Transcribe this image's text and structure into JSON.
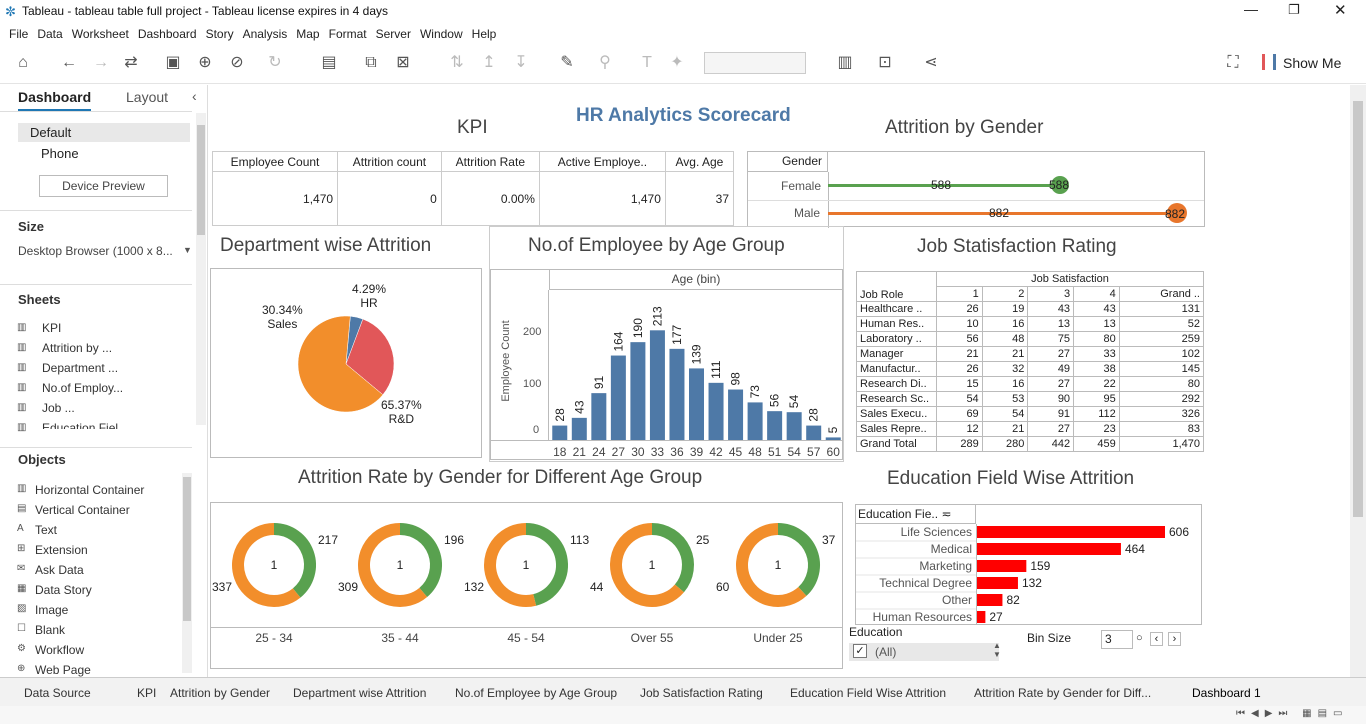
{
  "window": {
    "title": "Tableau - tableau table full project - Tableau license expires in 4 days"
  },
  "menu": [
    "File",
    "Data",
    "Worksheet",
    "Dashboard",
    "Story",
    "Analysis",
    "Map",
    "Format",
    "Server",
    "Window",
    "Help"
  ],
  "toolbar": {
    "show_me": "Show Me"
  },
  "left": {
    "tab_dashboard": "Dashboard",
    "tab_layout": "Layout",
    "device_default": "Default",
    "device_phone": "Phone",
    "device_preview": "Device Preview",
    "size_header": "Size",
    "size_value": "Desktop Browser (1000 x 8...",
    "sheets_header": "Sheets",
    "sheets": [
      "KPI",
      "Attrition by ...",
      "Department ...",
      "No.of Employ...",
      "Job ...",
      "Education Fiel..."
    ],
    "objects_header": "Objects",
    "objects": [
      "Horizontal Container",
      "Vertical Container",
      "Text",
      "Extension",
      "Ask Data",
      "Data Story",
      "Image",
      "Blank",
      "Workflow",
      "Web Page"
    ]
  },
  "dashboard": {
    "title": "HR  Analytics Scorecard",
    "kpi": {
      "title": "KPI",
      "headers": [
        "Employee Count",
        "Attrition count",
        "Attrition Rate",
        "Active Employe..",
        "Avg. Age"
      ],
      "values": [
        "1,470",
        "0",
        "0.00%",
        "1,470",
        "37"
      ]
    },
    "gender": {
      "title": "Attrition by Gender",
      "header": "Gender",
      "rows": [
        {
          "label": "Female",
          "value": "588",
          "value2": "588"
        },
        {
          "label": "Male",
          "value": "882",
          "value2": "882"
        }
      ]
    },
    "dept": {
      "title": "Department wise Attrition",
      "labels": [
        {
          "pct": "4.29%",
          "name": "HR"
        },
        {
          "pct": "30.34%",
          "name": "Sales"
        },
        {
          "pct": "65.37%",
          "name": "R&D"
        }
      ]
    },
    "age": {
      "title": "No.of Employee by Age Group",
      "header": "Age (bin)",
      "ylabel": "Employee Count",
      "ticks": [
        "200",
        "100",
        "0"
      ]
    },
    "job": {
      "title": "Job Statisfaction Rating",
      "group": "Job Satisfaction",
      "rowhead": "Job Role",
      "cols": [
        "1",
        "2",
        "3",
        "4",
        "Grand .."
      ],
      "rows": [
        [
          "Healthcare ..",
          "26",
          "19",
          "43",
          "43",
          "131"
        ],
        [
          "Human Res..",
          "10",
          "16",
          "13",
          "13",
          "52"
        ],
        [
          "Laboratory ..",
          "56",
          "48",
          "75",
          "80",
          "259"
        ],
        [
          "Manager",
          "21",
          "21",
          "27",
          "33",
          "102"
        ],
        [
          "Manufactur..",
          "26",
          "32",
          "49",
          "38",
          "145"
        ],
        [
          "Research Di..",
          "15",
          "16",
          "27",
          "22",
          "80"
        ],
        [
          "Research Sc..",
          "54",
          "53",
          "90",
          "95",
          "292"
        ],
        [
          "Sales Execu..",
          "69",
          "54",
          "91",
          "112",
          "326"
        ],
        [
          "Sales Repre..",
          "12",
          "21",
          "27",
          "23",
          "83"
        ],
        [
          "Grand Total",
          "289",
          "280",
          "442",
          "459",
          "1,470"
        ]
      ]
    },
    "donuts": {
      "title": "Attrition Rate by Gender for Different Age Group",
      "items": [
        {
          "label": "25 - 34",
          "center": "1",
          "a": "217",
          "b": "337"
        },
        {
          "label": "35 - 44",
          "center": "1",
          "a": "196",
          "b": "309"
        },
        {
          "label": "45 - 54",
          "center": "1",
          "a": "113",
          "b": "132"
        },
        {
          "label": "Over 55",
          "center": "1",
          "a": "25",
          "b": "44"
        },
        {
          "label": "Under 25",
          "center": "1",
          "a": "37",
          "b": "60"
        }
      ]
    },
    "edu": {
      "title": "Education Field Wise Attrition",
      "header": "Education Fie..",
      "rows": [
        {
          "name": "Life Sciences",
          "value": "606"
        },
        {
          "name": "Medical",
          "value": "464"
        },
        {
          "name": "Marketing",
          "value": "159"
        },
        {
          "name": "Technical Degree",
          "value": "132"
        },
        {
          "name": "Other",
          "value": "82"
        },
        {
          "name": "Human Resources",
          "value": "27"
        }
      ]
    },
    "filter": {
      "label": "Education",
      "value": "(All)"
    },
    "bin": {
      "label": "Bin Size",
      "value": "3"
    }
  },
  "tabs": [
    "Data Source",
    "KPI",
    "Attrition by Gender",
    "Department wise Attrition",
    "No.of Employee by Age Group",
    "Job Satisfaction Rating",
    "Education Field Wise Attrition",
    "Attrition Rate by Gender for Diff...",
    "Dashboard 1"
  ],
  "chart_data": [
    {
      "type": "bar",
      "title": "No.of Employee by Age Group",
      "xlabel": "Age (bin)",
      "ylabel": "Employee Count",
      "categories": [
        "18",
        "21",
        "24",
        "27",
        "30",
        "33",
        "36",
        "39",
        "42",
        "45",
        "48",
        "51",
        "54",
        "57",
        "60"
      ],
      "values": [
        28,
        43,
        91,
        164,
        190,
        213,
        177,
        139,
        111,
        98,
        73,
        56,
        54,
        28,
        5
      ],
      "ylim": [
        0,
        240
      ],
      "color": "#4e79a7"
    },
    {
      "type": "pie",
      "title": "Department wise Attrition",
      "categories": [
        "HR",
        "Sales",
        "R&D"
      ],
      "values": [
        4.29,
        30.34,
        65.37
      ],
      "colors": [
        "#4e79a7",
        "#e15759",
        "#f28e2b"
      ]
    },
    {
      "type": "bar",
      "title": "Education Field Wise Attrition",
      "categories": [
        "Life Sciences",
        "Medical",
        "Marketing",
        "Technical Degree",
        "Other",
        "Human Resources"
      ],
      "values": [
        606,
        464,
        159,
        132,
        82,
        27
      ],
      "color": "#ff0000"
    },
    {
      "type": "pie",
      "title": "Attrition Rate by Gender for Different Age Group",
      "categories": [
        "25 - 34",
        "35 - 44",
        "45 - 54",
        "Over 55",
        "Under 25"
      ],
      "series": [
        {
          "name": "Female",
          "values": [
            217,
            196,
            113,
            25,
            37
          ],
          "color": "#59a14f"
        },
        {
          "name": "Male",
          "values": [
            337,
            309,
            132,
            44,
            60
          ],
          "color": "#f28e2b"
        }
      ]
    }
  ]
}
